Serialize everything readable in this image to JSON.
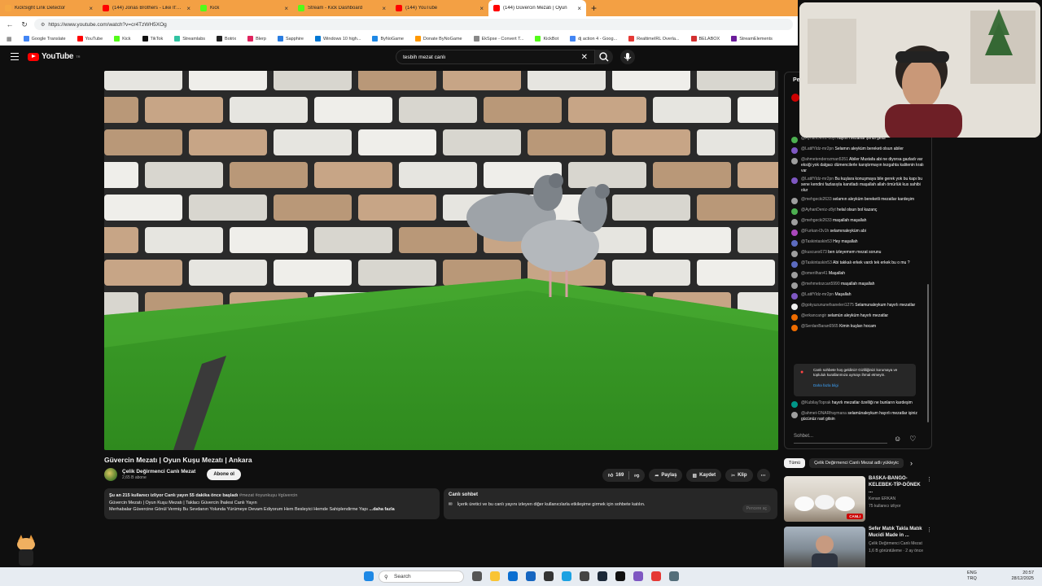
{
  "browser": {
    "tabs": [
      {
        "title": "KickSight Link Detector",
        "color": "#f5a742",
        "active": false
      },
      {
        "title": "(144) Jonas Brothers - Like It's Chr",
        "color": "#ff0000",
        "active": false
      },
      {
        "title": "Kick",
        "color": "#53fc18",
        "active": false
      },
      {
        "title": "Stream - Kick Dashboard",
        "color": "#53fc18",
        "active": false
      },
      {
        "title": "(144) YouTube",
        "color": "#ff0000",
        "active": false
      },
      {
        "title": "(144) Güvercin Mezatı | Oyun",
        "color": "#ff0000",
        "active": true
      }
    ],
    "new_tab": "+",
    "url": "https://www.youtube.com/watch?v=cr4TzWH5XOg",
    "bookmarks": [
      {
        "label": "Google Translate",
        "color": "#4285f4"
      },
      {
        "label": "YouTube",
        "color": "#ff0000"
      },
      {
        "label": "Kick",
        "color": "#53fc18"
      },
      {
        "label": "TikTok",
        "color": "#111111"
      },
      {
        "label": "Streamlabs",
        "color": "#31c3a2"
      },
      {
        "label": "Botrix",
        "color": "#222222"
      },
      {
        "label": "Blerp",
        "color": "#e0245e"
      },
      {
        "label": "Sapphire",
        "color": "#2a7de1"
      },
      {
        "label": "Windows 10 high...",
        "color": "#0078d4"
      },
      {
        "label": "ByNoGame",
        "color": "#1e88e5"
      },
      {
        "label": "Donate ByNoGame",
        "color": "#ff9800"
      },
      {
        "label": "EkSpse - Convert T...",
        "color": "#888888"
      },
      {
        "label": "KickBot",
        "color": "#53fc18"
      },
      {
        "label": "dj action 4 - Goog...",
        "color": "#4285f4"
      },
      {
        "label": "RealtimeIRL Overla...",
        "color": "#e53935"
      },
      {
        "label": "BELABOX",
        "color": "#d32f2f"
      },
      {
        "label": "StreamElements",
        "color": "#6a1b9a"
      }
    ]
  },
  "youtube": {
    "logo": "YouTube",
    "logo_region": "TR",
    "search_value": "tesbih mezat canlı"
  },
  "video": {
    "title": "Güvercin Mezatı | Oyun Kuşu Mezatı | Ankara",
    "channel_name": "Çelik Değirmenci Canlı Mezat",
    "subscribers": "2,65 B abone",
    "subscribe_label": "Abone ol",
    "likes": "169",
    "share_label": "Paylaş",
    "save_label": "Kaydet",
    "clip_label": "Klip",
    "desc_stats": "Şu an 215 kullanıcı izliyor  Canlı yayın 55 dakika önce başladı",
    "desc_tags": "#mezat #oyunkuşu #güvercin",
    "desc_line2": "Güvercin Mezatı | Oyun Kuşu Mezatı | Taklacı Güvercin İhalesi Canlı Yayın",
    "desc_line3": "Merhabalar  Güvercine Gönül Vermiş Bu Sevdanın Yolunda Yürümeye Devam Ediyorum Hem Besleyici Hemde Sahiplendirme Yapı",
    "desc_more": "...daha fazla",
    "live_chat_title": "Canlı sohbet",
    "live_chat_text": "İçerik üretici ve bu canlı yayını izleyen diğer kullanıcılarla etkileşime girmek için sohbete katılın.",
    "live_chat_open": "Pencere aç"
  },
  "chat": {
    "header_partial": "Pe",
    "messages": [
      {
        "user": "@AyhanDeniz-z8yt",
        "text": "hayırlı mezarlar şimdi geldi",
        "color": "#4caf50"
      },
      {
        "user": "@LatifYldz-mr2pn",
        "text": "Selamın aleyküm bereketi olsun abiler",
        "color": "#7e57c2"
      },
      {
        "user": "@ahmetenderozman5351",
        "text": "Abiler Mustafa abi ne diyorsa gazladı var eksiği yok dalgacı dümencilerle karıştırmayın tezgahta kalitenin kralı var",
        "color": "#9e9e9e"
      },
      {
        "user": "@LatifYldz-mr2pn",
        "text": "Bu kuşlara konuşmaya bile gerek yok bu kapı bu sene kendini fazlasıyla kanıtladı maşallah allah ömürlük kus sahibi olur",
        "color": "#7e57c2"
      },
      {
        "user": "@mehgecki2633",
        "text": "selamın aleyküm bereketli mezatlar kardeşim",
        "color": "#9e9e9e"
      },
      {
        "user": "@AyhanDeniz-z8yt",
        "text": "helal olsun bol kazanç",
        "color": "#4caf50"
      },
      {
        "user": "@mehgecki2633",
        "text": "maşallah maşallah",
        "color": "#9e9e9e"
      },
      {
        "user": "@Furkan-l3v1h",
        "text": "selamınaleyküm abi",
        "color": "#ab47bc"
      },
      {
        "user": "@Taskintaskin53",
        "text": "Hey maşallah",
        "color": "#5c6bc0"
      },
      {
        "user": "@kuscues673",
        "text": "ben izleyemem mezat sorunu",
        "color": "#9e9e9e"
      },
      {
        "user": "@Taskintaskin53",
        "text": "Abi takkalı erkek vardı tek erkek bu o mu ?",
        "color": "#5c6bc0"
      },
      {
        "user": "@omerilhan41",
        "text": "Maşallah",
        "color": "#9e9e9e"
      },
      {
        "user": "@mehmetozcan5990",
        "text": "maşallah maşallah",
        "color": "#9e9e9e"
      },
      {
        "user": "@LatifYldz-mr2pn",
        "text": "Maşallah",
        "color": "#7e57c2"
      },
      {
        "user": "@gokyuzununefsaneleri1275",
        "text": "Selamunaleykum hayırlı mezatlar",
        "color": "#eeeeee"
      },
      {
        "user": "@erkancangir",
        "text": "selamün aleyküm hayırlı mezatlar",
        "color": "#ef6c00"
      },
      {
        "user": "@SerdanBaran6565",
        "text": "Kimin kuşları hocam",
        "color": "#ef6c00"
      }
    ],
    "welcome_text": "Canlı sohbete hoş geldiniz! Gizliliğinizi korumaya ve topluluk kurallarımıza uymayı ihmal etmeyin.",
    "welcome_more": "Daha fazla bilgi",
    "after_messages": [
      {
        "user": "@KubilayToprak",
        "text": "hayırlı mezatlar özelliği ne bunların kardeşim",
        "color": "#009688"
      },
      {
        "user": "@ahmet-ONARfraymana",
        "text": "selamünaleykum hayırlı mezatlar işiniz gücünüz rast gitsin",
        "color": "#9e9e9e"
      }
    ],
    "input_placeholder": "Sohbet..."
  },
  "related": {
    "chips": [
      "Tümü",
      "Çelik Değirmenci Canlı Mezat adlı yükleyic"
    ],
    "items": [
      {
        "title": "BASKA-BANGO-KELEBEK-TİP-DÖNEK ...",
        "channel": "Kenan ERKAN",
        "meta": "75 kullanıcı izliyor",
        "badge": "CANLI"
      },
      {
        "title": "Sefer Matık Takla Matık Mucidi Made in ...",
        "channel": "Çelik Değirmenci Canlı Mezat",
        "meta": "1,6 B görüntüleme · 2 ay önce",
        "badge": ""
      }
    ]
  },
  "taskbar": {
    "search": "Search",
    "lang_top": "ENG",
    "lang_bottom": "TRQ",
    "time": "20:57",
    "date": "28/12/2025"
  },
  "colors": {
    "accent": "#ff0000",
    "tabbar": "#f3a044"
  }
}
